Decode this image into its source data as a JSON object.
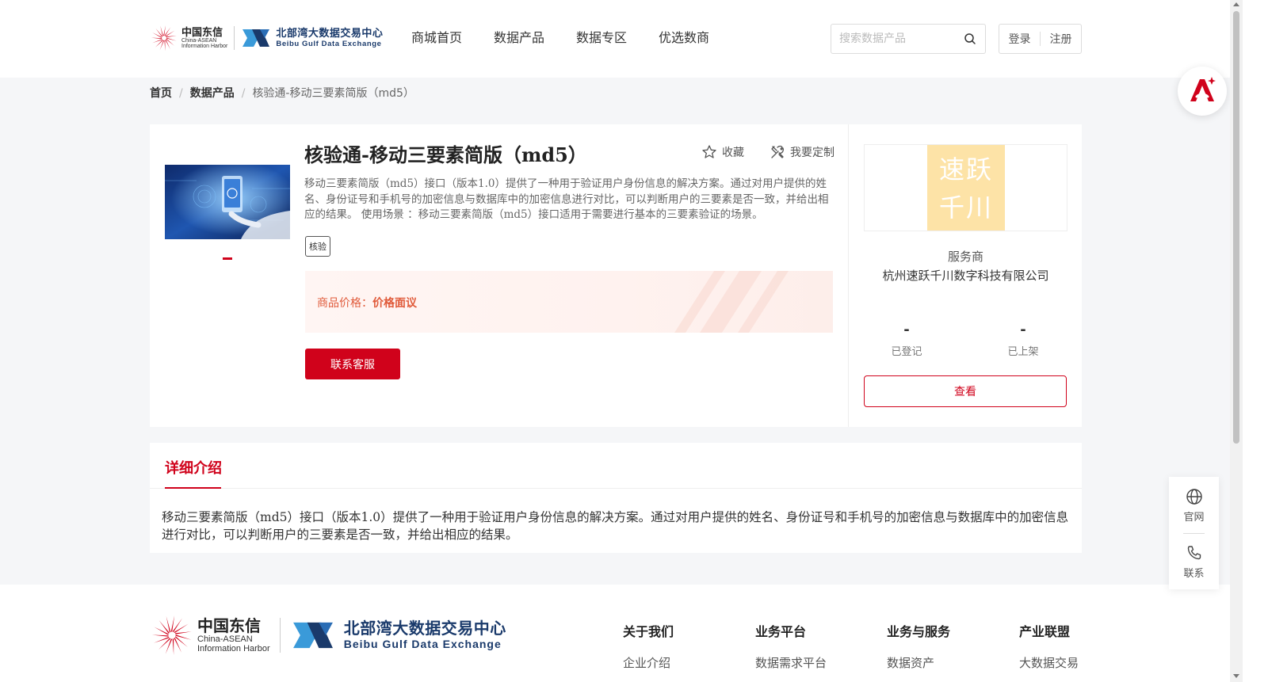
{
  "header": {
    "logo_cei": {
      "cn": "中国东信",
      "en1": "China-ASEAN",
      "en2": "Information Harbor"
    },
    "logo_bgx": {
      "cn": "北部湾大数据交易中心",
      "en": "Beibu Gulf Data Exchange"
    },
    "nav": [
      "商城首页",
      "数据产品",
      "数据专区",
      "优选数商"
    ],
    "search": {
      "placeholder": "搜索数据产品",
      "value": "",
      "icon": "search-icon"
    },
    "auth": {
      "login": "登录",
      "register": "注册"
    }
  },
  "breadcrumb": {
    "items": [
      "首页",
      "数据产品"
    ],
    "separator": "/",
    "current": "核验通-移动三要素简版（md5）"
  },
  "product": {
    "title": "核验通-移动三要素简版（md5）",
    "actions": {
      "favorite": "收藏",
      "customize": "我要定制"
    },
    "description": "移动三要素简版（md5）接口（版本1.0）提供了一种用于验证用户身份信息的解决方案。通过对用户提供的姓名、身份证号和手机号的加密信息与数据库中的加密信息进行对比，可以判断用户的三要素是否一致，并给出相应的结果。 使用场景 ：移动三要素简版（md5）接口适用于需要进行基本的三要素验证的场景。",
    "tag": "核验",
    "price_label": "商品价格：",
    "price_value": "价格面议",
    "contact_button": "联系客服"
  },
  "vendor": {
    "logo_text_1": "速跃",
    "logo_text_2": "千川",
    "role": "服务商",
    "name": "杭州速跃千川数字科技有限公司",
    "stats": [
      {
        "value": "-",
        "label": "已登记"
      },
      {
        "value": "-",
        "label": "已上架"
      }
    ],
    "view_button": "查看"
  },
  "detail": {
    "tab": "详细介绍",
    "body": "移动三要素简版（md5）接口（版本1.0）提供了一种用于验证用户身份信息的解决方案。通过对用户提供的姓名、身份证号和手机号的加密信息与数据库中的加密信息进行对比，可以判断用户的三要素是否一致，并给出相应的结果。"
  },
  "footer": {
    "logo_cei": {
      "cn": "中国东信",
      "en1": "China-ASEAN",
      "en2": "Information Harbor"
    },
    "logo_bgx": {
      "cn": "北部湾大数据交易中心",
      "en": "Beibu Gulf Data Exchange"
    },
    "columns": [
      {
        "title": "关于我们",
        "item": "企业介绍"
      },
      {
        "title": "业务平台",
        "item": "数据需求平台"
      },
      {
        "title": "业务与服务",
        "item": "数据资产"
      },
      {
        "title": "产业联盟",
        "item": "大数据交易"
      }
    ]
  },
  "side_dock": {
    "website": "官网",
    "contact": "联系"
  },
  "colors": {
    "brand_red": "#d0021b",
    "price_orange": "#e05a3a",
    "vendor_logo_bg": "#fde3a7",
    "bgx_blue": "#1a3a6b"
  }
}
